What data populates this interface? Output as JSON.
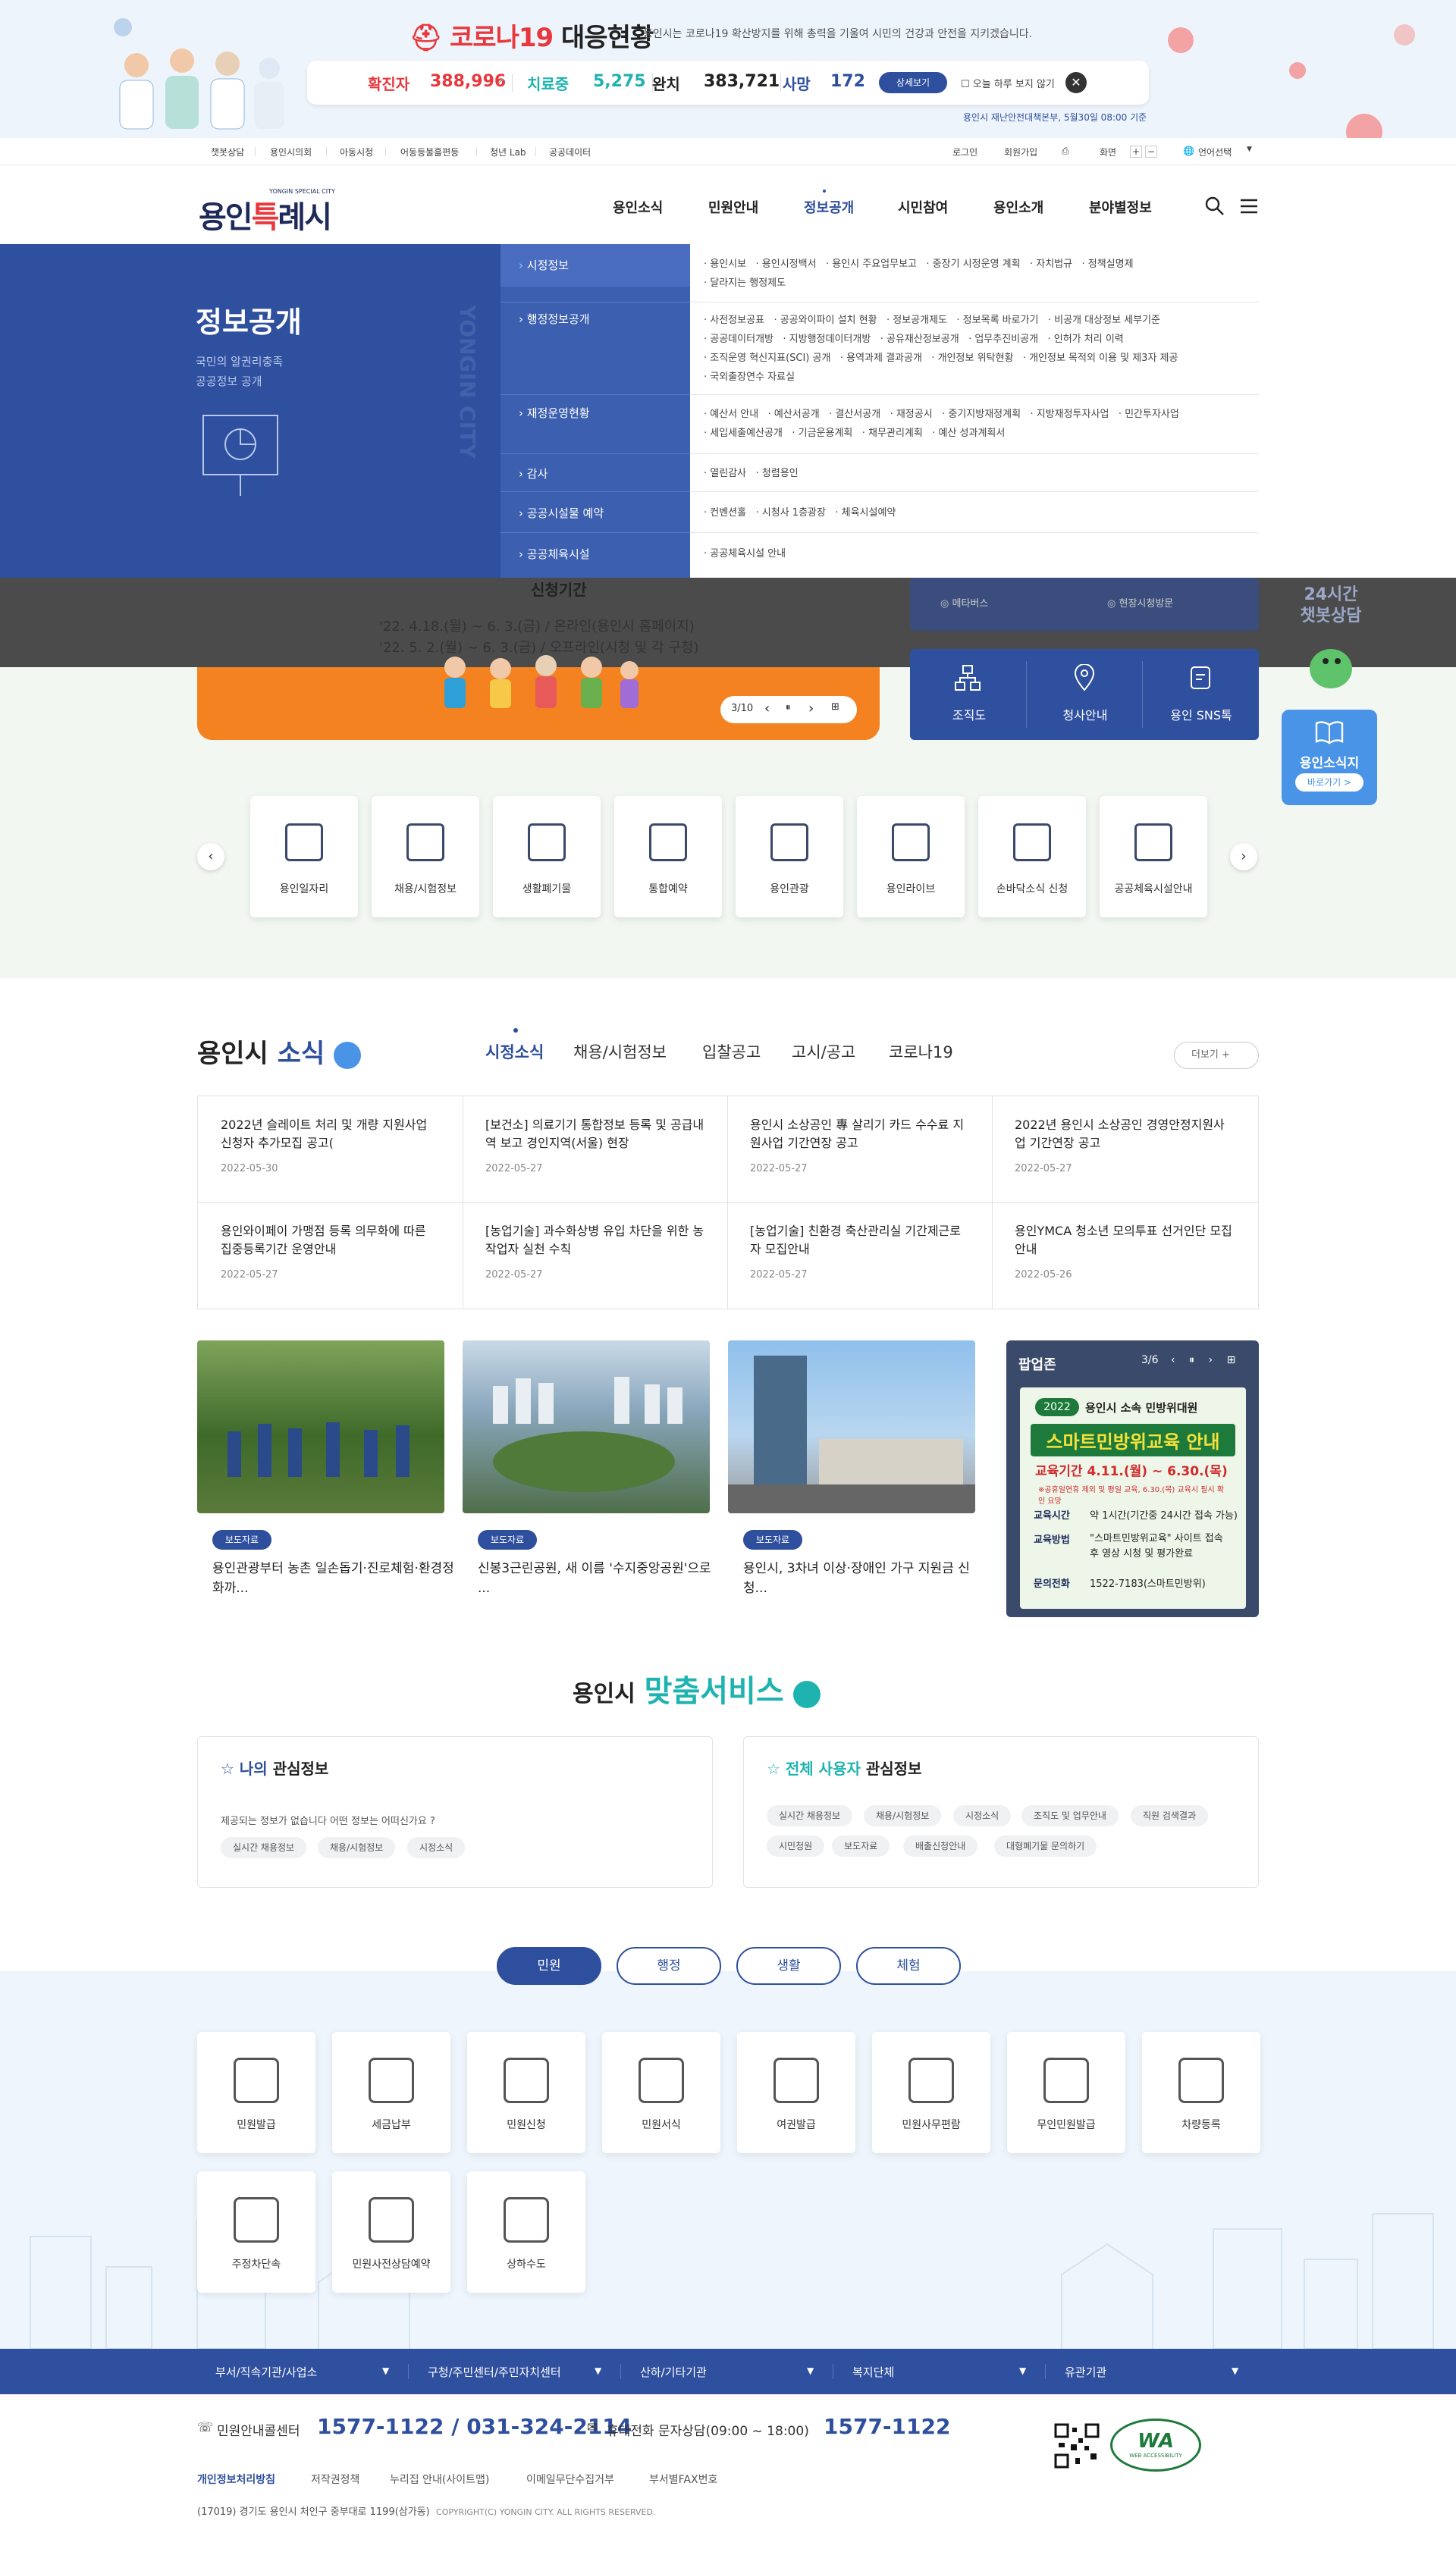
{
  "covid": {
    "title_red": "코로나19",
    "title_rest": "대응현황",
    "desc": "용인시는 코로나19 확산방지를 위해 총력을 기울여 시민의 건강과 안전을 지키겠습니다.",
    "confirmed_label": "확진자",
    "confirmed_value": "388,996",
    "treated_label": "치료중",
    "treated_value": "5,275",
    "recovered_label": "완치",
    "recovered_value": "383,721",
    "death_label": "사망",
    "death_value": "172",
    "detail_button": "상세보기",
    "hide_today": "오늘 하루 보지 않기",
    "close": "✕",
    "source": "용인시 재난안전대책본부, 5월30일 08:00 기준",
    "colors": {
      "confirmed": "#e8383d",
      "treated": "#1fb3b0",
      "death": "#2d4f9e"
    }
  },
  "topbar": {
    "left": [
      "챗봇상담",
      "용인시의회",
      "아동시청",
      "어동등불흘편등",
      "청년 Lab",
      "공공데이터"
    ],
    "login": "로그인",
    "join": "회원가입",
    "screen_label": "화면",
    "zoom_in": "+",
    "zoom_out": "−",
    "language": "언어선택"
  },
  "header": {
    "logo_text": "용인",
    "logo_accent": "특",
    "logo_rest": "례시",
    "logo_sub": "YONGIN SPECIAL CITY",
    "nav": [
      "용인소식",
      "민원안내",
      "정보공개",
      "시민참여",
      "용인소개",
      "분야별정보"
    ],
    "search_icon": "search-icon",
    "menu_icon": "hamburger-icon"
  },
  "mega": {
    "title": "정보공개",
    "sub1": "국민의 알권리충족",
    "sub2": "공공정보 공개",
    "watermark": "YONGIN CITY",
    "categories": [
      {
        "label": "시정정보",
        "items": [
          "· 용인시보",
          "· 용인시정백서",
          "· 용인시 주요업무보고",
          "· 중장기 시정운영 계획",
          "· 자치법규",
          "· 정책실명제",
          "· 달라지는 행정제도"
        ]
      },
      {
        "label": "행정정보공개",
        "items": [
          "· 사전정보공표",
          "· 공공와이파이 설치 현황",
          "· 정보공개제도",
          "· 정보목록 바로가기",
          "· 비공개 대상정보 세부기준",
          "· 공공데이터개방",
          "· 지방행정데이터개방",
          "· 공유재산정보공개",
          "· 업무추진비공개",
          "· 인허가 처리 이력",
          "· 조직운영 혁신지표(SCI) 공개",
          "· 용역과제 결과공개",
          "· 개인정보 위탁현황",
          "· 개인정보 목적외 이용 및 제3자 제공",
          "· 국외출장연수 자료실"
        ]
      },
      {
        "label": "재정운영현황",
        "items": [
          "· 예산서 안내",
          "· 예산서공개",
          "· 결산서공개",
          "· 재정공시",
          "· 중기지방재정계획",
          "· 지방재정투자사업",
          "· 민간투자사업",
          "· 세입세출예산공개",
          "· 기금운용계획",
          "· 채무관리계획",
          "· 예산 성과계획서"
        ]
      },
      {
        "label": "감사",
        "items": [
          "· 열린감사",
          "· 청렴용인"
        ]
      },
      {
        "label": "공공시설물 예약",
        "items": [
          "· 컨벤션홀",
          "· 시청사 1층광장",
          "· 체육시설예약"
        ]
      },
      {
        "label": "공공체육시설",
        "items": [
          "· 공공체육시설 안내"
        ]
      }
    ]
  },
  "hero": {
    "period_title": "신청기간",
    "line1": "'22. 4.18.(월) ~ 6. 3.(금) / 온라인(용인시 홈페이지)",
    "line2": "'22. 5. 2.(월) ~ 6. 3.(금) / 오프라인(시청 및 각 구청)",
    "page": "3/10",
    "prev": "‹",
    "pause": "⏸",
    "next": "›",
    "all": "⊞"
  },
  "quick_links": {
    "top_left": "메타버스",
    "top_right": "현장시청방문",
    "items": [
      "조직도",
      "청사안내",
      "용인 SNS톡"
    ]
  },
  "chatbot": {
    "line1": "24시간",
    "line2": "챗봇상담"
  },
  "news_badge": {
    "title": "용인소식지",
    "button": "바로가기 >"
  },
  "service_cards": [
    "용인일자리",
    "채용/시험정보",
    "생활폐기물",
    "통합예약",
    "용인관광",
    "용인라이브",
    "손바닥소식 신청",
    "공공체육시설안내"
  ],
  "news": {
    "title_a": "용인시",
    "title_b": "소식",
    "tabs": [
      "시정소식",
      "채용/시험정보",
      "입찰공고",
      "고시/공고",
      "코로나19"
    ],
    "more": "더보기   +",
    "items": [
      {
        "title": "2022년 슬레이트 처리 및 개량 지원사업 신청자 추가모집 공고(",
        "date": "2022-05-30"
      },
      {
        "title": "[보건소] 의료기기 통합정보 등록 및 공급내역 보고 경인지역(서울) 현장",
        "date": "2022-05-27"
      },
      {
        "title": "용인시 소상공인 專 살리기 카드 수수료 지원사업 기간연장 공고",
        "date": "2022-05-27"
      },
      {
        "title": "2022년 용인시 소상공인 경영안정지원사업 기간연장 공고",
        "date": "2022-05-27"
      },
      {
        "title": "용인와이페이 가맹점 등록 의무화에 따른 집중등록기간 운영안내",
        "date": "2022-05-27"
      },
      {
        "title": "[농업기술] 과수화상병 유입 차단을 위한 농작업자 실천 수칙",
        "date": "2022-05-27"
      },
      {
        "title": "[농업기술] 친환경 축산관리실 기간제근로자 모집안내",
        "date": "2022-05-27"
      },
      {
        "title": "용인YMCA 청소년 모의투표 선거인단 모집 안내",
        "date": "2022-05-26"
      }
    ]
  },
  "photos": [
    {
      "badge": "보도자료",
      "caption": "용인관광부터 농촌 일손돕기·진로체험·환경정화까..."
    },
    {
      "badge": "보도자료",
      "caption": "신봉3근린공원, 새 이름 '수지중앙공원'으로 ..."
    },
    {
      "badge": "보도자료",
      "caption": "용인시, 3차녀 이상·장애인 가구 지원금 신청..."
    }
  ],
  "popup": {
    "title": "팝업존",
    "page": "3/6",
    "year": "2022",
    "org": "용인시 소속 민방위대원",
    "headline": "스마트민방위교육 안내",
    "period": "교육기간 4.11.(월) ~ 6.30.(목)",
    "note": "※공휴일연휴 제외 및 평일 교육, 6.30.(목) 교육시 필시 확인 요망",
    "time_label": "교육시간",
    "time_value": "약 1시간(기간중 24시간 접속 가능)",
    "method_label": "교육방법",
    "method_value": "\"스마트민방위교육\" 사이트 접속 후 영상 시청 및 평가완료",
    "contact_label": "문의전화",
    "contact_value": "1522-7183(스마트민방위)"
  },
  "custom": {
    "title_a": "용인시",
    "title_b": "맞춤서비스",
    "mine_title_a": "나의",
    "mine_title_b": "관심정보",
    "mine_desc": "제공되는 정보가 없습니다 어떤 정보는 어떠신가요 ?",
    "mine_tags": [
      "실시간 채용정보",
      "채용/시험정보",
      "시정소식"
    ],
    "all_title_a": "전체 사용자",
    "all_title_b": "관심정보",
    "all_tags": [
      "실시간 채용정보",
      "채용/시험정보",
      "시정소식",
      "조직도 및 업무안내",
      "직원 검색결과",
      "시민청원",
      "보도자료",
      "배출신청안내",
      "대형폐기물 문의하기"
    ]
  },
  "services": {
    "tabs": [
      "민원",
      "행정",
      "생활",
      "체험"
    ],
    "items": [
      "민원발급",
      "세금납부",
      "민원신청",
      "민원서식",
      "여권발급",
      "민원사무편람",
      "무인민원발급",
      "차량등록",
      "주정차단속",
      "민원사전상담예약",
      "상하수도"
    ]
  },
  "footer_nav": [
    "부서/직속기관/사업소",
    "구청/주민센터/주민자치센터",
    "산하/기타기관",
    "복지단체",
    "유관기관"
  ],
  "footer": {
    "center_label": "민원안내콜센터",
    "center_phone": "1577-1122 / 031-324-2114",
    "sms_label": "휴대전화 문자상담(09:00 ~ 18:00)",
    "sms_phone": "1577-1122",
    "links": [
      "개인정보처리방침",
      "저작권정책",
      "누리집 안내(사이트맵)",
      "이메일무단수집거부",
      "부서별FAX번호"
    ],
    "address": "(17019) 경기도 용인시 처인구 중부대로 1199(삼가동)",
    "copyright": "COPYRIGHT(C) YONGIN CITY. ALL RIGHTS RESERVED.",
    "wa_label": "WA",
    "wa_sub": "WEB ACCESSIBILITY"
  }
}
